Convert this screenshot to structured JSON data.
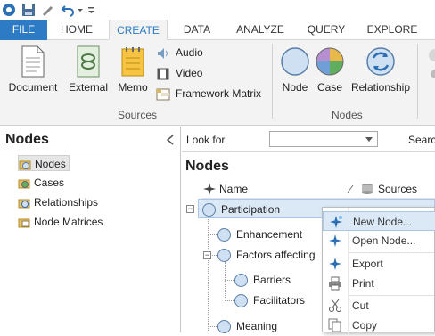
{
  "tabs": [
    {
      "label": "FILE"
    },
    {
      "label": "HOME"
    },
    {
      "label": "CREATE"
    },
    {
      "label": "DATA"
    },
    {
      "label": "ANALYZE"
    },
    {
      "label": "QUERY"
    },
    {
      "label": "EXPLORE"
    }
  ],
  "ribbon": {
    "sources": {
      "document": "Document",
      "external": "External",
      "memo": "Memo",
      "audio": "Audio",
      "video": "Video",
      "framework_matrix": "Framework Matrix",
      "group_label": "Sources"
    },
    "nodes": {
      "node": "Node",
      "case": "Case",
      "relationship": "Relationship",
      "group_label": "Nodes"
    }
  },
  "nav": {
    "title": "Nodes",
    "items": [
      {
        "label": "Nodes"
      },
      {
        "label": "Cases"
      },
      {
        "label": "Relationships"
      },
      {
        "label": "Node Matrices"
      }
    ]
  },
  "main": {
    "look_for_label": "Look for",
    "search_label": "Searc",
    "title": "Nodes",
    "col_name": "Name",
    "col_sources": "Sources",
    "tree": [
      {
        "label": "Participation"
      },
      {
        "label": "Enhancement"
      },
      {
        "label": "Factors affecting"
      },
      {
        "label": "Barriers"
      },
      {
        "label": "Facilitators"
      },
      {
        "label": "Meaning"
      }
    ]
  },
  "context_menu": {
    "items": [
      {
        "label": "New Node..."
      },
      {
        "label": "Open Node..."
      },
      {
        "label": "Export"
      },
      {
        "label": "Print"
      },
      {
        "label": "Cut"
      },
      {
        "label": "Copy"
      }
    ]
  },
  "colors": {
    "accent": "#2c7bc4",
    "ribbon_bg": "#f3f3f3",
    "highlight": "#dbe8f6"
  }
}
